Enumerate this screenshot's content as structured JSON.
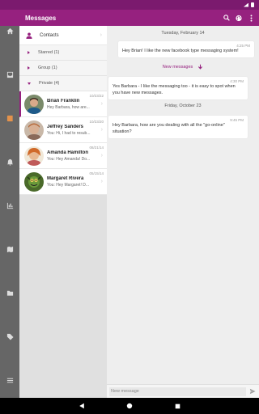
{
  "status_bar": {
    "time": ""
  },
  "app_bar": {
    "title": "Messages",
    "actions": [
      "search-icon",
      "palette-icon",
      "more-vert-icon"
    ]
  },
  "left_rail": {
    "items": [
      "home-icon",
      "inbox-icon",
      "book-icon",
      "notifications-icon",
      "bar-chart-icon",
      "map-icon",
      "folder-icon",
      "tag-icon",
      "menu-icon"
    ],
    "active": "book-icon"
  },
  "sidebar": {
    "contacts_label": "Contacts",
    "groups": [
      {
        "label": "Starred (1)",
        "expanded": false
      },
      {
        "label": "Group (1)",
        "expanded": false
      },
      {
        "label": "Private (4)",
        "expanded": true
      }
    ],
    "conversations": [
      {
        "name": "Brian Franklin",
        "preview": "Hey Barbara, how are...",
        "date": "10/23/22",
        "selected": true
      },
      {
        "name": "Jeffrey Sanders",
        "preview": "You: Hi, I had to resub...",
        "date": "10/23/20",
        "selected": false
      },
      {
        "name": "Amanda Hamilton",
        "preview": "You: Hey Amanda! Do...",
        "date": "08/21/14",
        "selected": false
      },
      {
        "name": "Margaret Rivera",
        "preview": "You: Hey Margaret! D...",
        "date": "05/15/14",
        "selected": false
      }
    ]
  },
  "chat": {
    "date1": "Tuesday, February 14",
    "msg1": {
      "time": "4:25 PM",
      "text": "Hey Brian! I like the new facebook type messaging system!"
    },
    "new_messages_label": "New messages",
    "msg2": {
      "time": "4:30 PM",
      "text": "Yes Barbara - I like the messaging too - it is easy to spot when you have new messages."
    },
    "date2": "Friday, October 23",
    "msg3": {
      "time": "9:45 PM",
      "text": "Hey Barbara, how are you dealing with all the \"go-online\" situation?"
    },
    "compose_placeholder": "New message"
  },
  "colors": {
    "primary": "#96217f",
    "status": "#7b1a6e",
    "rail": "#666666",
    "accent": "#e3924c"
  }
}
